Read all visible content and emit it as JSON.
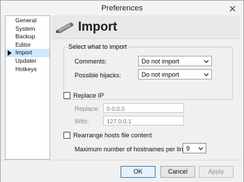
{
  "window": {
    "title": "Preferences"
  },
  "sidebar": {
    "items": [
      {
        "label": "General",
        "active": false
      },
      {
        "label": "System",
        "active": false
      },
      {
        "label": "Backup",
        "active": false
      },
      {
        "label": "Editor",
        "active": false
      },
      {
        "label": "Import",
        "active": true
      },
      {
        "label": "Updater",
        "active": false
      },
      {
        "label": "Hotkeys",
        "active": false
      }
    ]
  },
  "header": {
    "title": "Import"
  },
  "import_group": {
    "title": "Select what to import",
    "comments_label": "Comments:",
    "comments_value": "Do not import",
    "hijacks_label": "Possible hijacks:",
    "hijacks_value": "Do not import"
  },
  "replace_ip": {
    "label": "Replace IP",
    "checked": false,
    "replace_label": "Replace:",
    "replace_value": "0.0.0.0",
    "with_label": "With:",
    "with_value": "127.0.0.1"
  },
  "rearrange": {
    "label": "Rearrange hosts file content",
    "checked": false,
    "max_label": "Maximum number of hostnames per line:",
    "max_value": "9"
  },
  "footer": {
    "ok_label": "OK",
    "cancel_label": "Cancel",
    "apply_label": "Apply"
  },
  "colors": {
    "active_item": "#cde8ff",
    "default_button_border": "#3c7fb1"
  }
}
